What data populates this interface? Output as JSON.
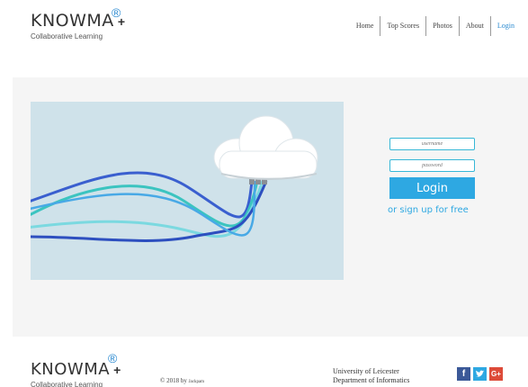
{
  "brand": {
    "name": "KNOWMA",
    "plus": "+",
    "registered": "®",
    "tagline": "Collaborative Learning"
  },
  "nav": {
    "items": [
      {
        "label": "Home"
      },
      {
        "label": "Top Scores"
      },
      {
        "label": "Photos"
      },
      {
        "label": "About"
      },
      {
        "label": "Login"
      }
    ],
    "active": "Login"
  },
  "login": {
    "username_placeholder": "username",
    "password_placeholder": "password",
    "button_label": "Login",
    "signup_text": "or sign up for free"
  },
  "footer": {
    "copyright": "© 2018 by",
    "author": "Jackpam",
    "university_line1": "University of Leicester",
    "university_line2": "Department of Informatics",
    "social": {
      "facebook": "f",
      "twitter": "t",
      "googleplus": "G+"
    }
  },
  "colors": {
    "accent": "#2ea8e2",
    "field_border": "#36b7d7",
    "band": "#f5f5f5",
    "hero_bg": "#cfe2ea",
    "facebook": "#3b5998",
    "googleplus": "#dd4b39"
  }
}
